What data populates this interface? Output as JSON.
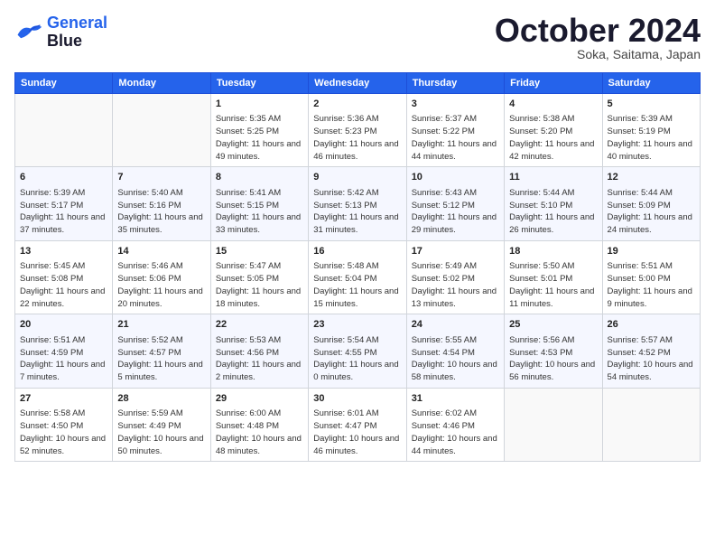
{
  "header": {
    "logo_line1": "General",
    "logo_line2": "Blue",
    "month": "October 2024",
    "location": "Soka, Saitama, Japan"
  },
  "weekdays": [
    "Sunday",
    "Monday",
    "Tuesday",
    "Wednesday",
    "Thursday",
    "Friday",
    "Saturday"
  ],
  "weeks": [
    [
      {
        "day": "",
        "info": ""
      },
      {
        "day": "",
        "info": ""
      },
      {
        "day": "1",
        "info": "Sunrise: 5:35 AM\nSunset: 5:25 PM\nDaylight: 11 hours and 49 minutes."
      },
      {
        "day": "2",
        "info": "Sunrise: 5:36 AM\nSunset: 5:23 PM\nDaylight: 11 hours and 46 minutes."
      },
      {
        "day": "3",
        "info": "Sunrise: 5:37 AM\nSunset: 5:22 PM\nDaylight: 11 hours and 44 minutes."
      },
      {
        "day": "4",
        "info": "Sunrise: 5:38 AM\nSunset: 5:20 PM\nDaylight: 11 hours and 42 minutes."
      },
      {
        "day": "5",
        "info": "Sunrise: 5:39 AM\nSunset: 5:19 PM\nDaylight: 11 hours and 40 minutes."
      }
    ],
    [
      {
        "day": "6",
        "info": "Sunrise: 5:39 AM\nSunset: 5:17 PM\nDaylight: 11 hours and 37 minutes."
      },
      {
        "day": "7",
        "info": "Sunrise: 5:40 AM\nSunset: 5:16 PM\nDaylight: 11 hours and 35 minutes."
      },
      {
        "day": "8",
        "info": "Sunrise: 5:41 AM\nSunset: 5:15 PM\nDaylight: 11 hours and 33 minutes."
      },
      {
        "day": "9",
        "info": "Sunrise: 5:42 AM\nSunset: 5:13 PM\nDaylight: 11 hours and 31 minutes."
      },
      {
        "day": "10",
        "info": "Sunrise: 5:43 AM\nSunset: 5:12 PM\nDaylight: 11 hours and 29 minutes."
      },
      {
        "day": "11",
        "info": "Sunrise: 5:44 AM\nSunset: 5:10 PM\nDaylight: 11 hours and 26 minutes."
      },
      {
        "day": "12",
        "info": "Sunrise: 5:44 AM\nSunset: 5:09 PM\nDaylight: 11 hours and 24 minutes."
      }
    ],
    [
      {
        "day": "13",
        "info": "Sunrise: 5:45 AM\nSunset: 5:08 PM\nDaylight: 11 hours and 22 minutes."
      },
      {
        "day": "14",
        "info": "Sunrise: 5:46 AM\nSunset: 5:06 PM\nDaylight: 11 hours and 20 minutes."
      },
      {
        "day": "15",
        "info": "Sunrise: 5:47 AM\nSunset: 5:05 PM\nDaylight: 11 hours and 18 minutes."
      },
      {
        "day": "16",
        "info": "Sunrise: 5:48 AM\nSunset: 5:04 PM\nDaylight: 11 hours and 15 minutes."
      },
      {
        "day": "17",
        "info": "Sunrise: 5:49 AM\nSunset: 5:02 PM\nDaylight: 11 hours and 13 minutes."
      },
      {
        "day": "18",
        "info": "Sunrise: 5:50 AM\nSunset: 5:01 PM\nDaylight: 11 hours and 11 minutes."
      },
      {
        "day": "19",
        "info": "Sunrise: 5:51 AM\nSunset: 5:00 PM\nDaylight: 11 hours and 9 minutes."
      }
    ],
    [
      {
        "day": "20",
        "info": "Sunrise: 5:51 AM\nSunset: 4:59 PM\nDaylight: 11 hours and 7 minutes."
      },
      {
        "day": "21",
        "info": "Sunrise: 5:52 AM\nSunset: 4:57 PM\nDaylight: 11 hours and 5 minutes."
      },
      {
        "day": "22",
        "info": "Sunrise: 5:53 AM\nSunset: 4:56 PM\nDaylight: 11 hours and 2 minutes."
      },
      {
        "day": "23",
        "info": "Sunrise: 5:54 AM\nSunset: 4:55 PM\nDaylight: 11 hours and 0 minutes."
      },
      {
        "day": "24",
        "info": "Sunrise: 5:55 AM\nSunset: 4:54 PM\nDaylight: 10 hours and 58 minutes."
      },
      {
        "day": "25",
        "info": "Sunrise: 5:56 AM\nSunset: 4:53 PM\nDaylight: 10 hours and 56 minutes."
      },
      {
        "day": "26",
        "info": "Sunrise: 5:57 AM\nSunset: 4:52 PM\nDaylight: 10 hours and 54 minutes."
      }
    ],
    [
      {
        "day": "27",
        "info": "Sunrise: 5:58 AM\nSunset: 4:50 PM\nDaylight: 10 hours and 52 minutes."
      },
      {
        "day": "28",
        "info": "Sunrise: 5:59 AM\nSunset: 4:49 PM\nDaylight: 10 hours and 50 minutes."
      },
      {
        "day": "29",
        "info": "Sunrise: 6:00 AM\nSunset: 4:48 PM\nDaylight: 10 hours and 48 minutes."
      },
      {
        "day": "30",
        "info": "Sunrise: 6:01 AM\nSunset: 4:47 PM\nDaylight: 10 hours and 46 minutes."
      },
      {
        "day": "31",
        "info": "Sunrise: 6:02 AM\nSunset: 4:46 PM\nDaylight: 10 hours and 44 minutes."
      },
      {
        "day": "",
        "info": ""
      },
      {
        "day": "",
        "info": ""
      }
    ]
  ]
}
